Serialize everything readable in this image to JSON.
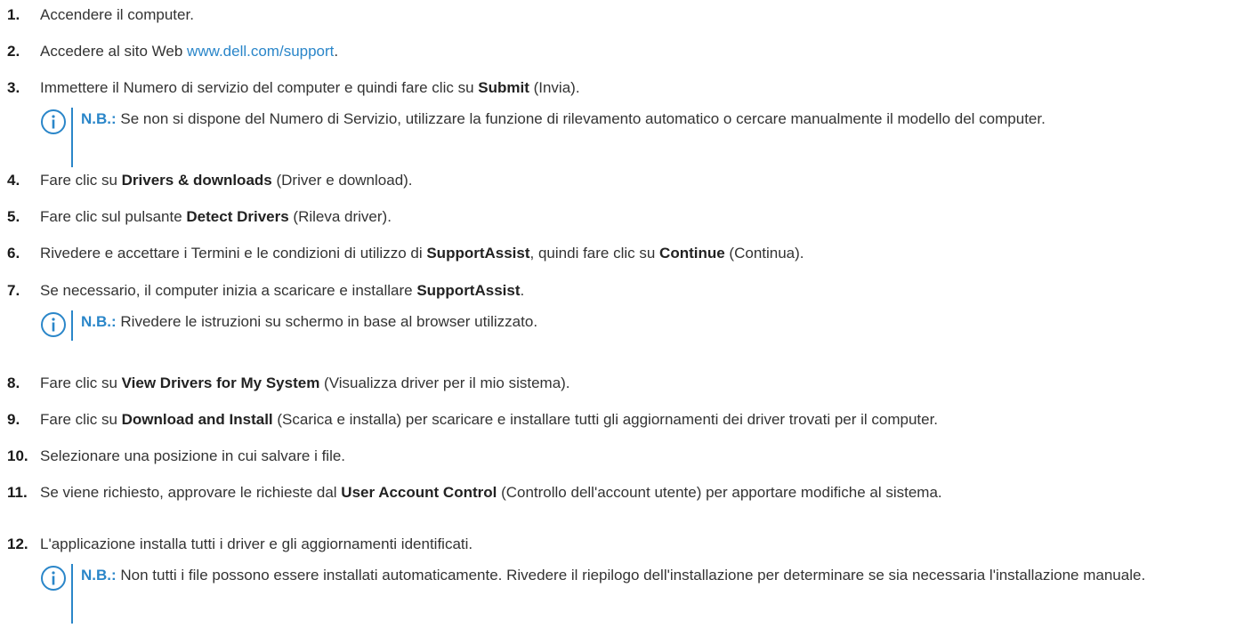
{
  "steps": [
    {
      "num": "1.",
      "parts": [
        {
          "t": "Accendere il computer."
        }
      ]
    },
    {
      "num": "2.",
      "parts": [
        {
          "t": "Accedere al sito Web "
        },
        {
          "t": "www.dell.com/support",
          "link": true
        },
        {
          "t": "."
        }
      ]
    },
    {
      "num": "3.",
      "parts": [
        {
          "t": "Immettere il Numero di servizio del computer e quindi fare clic su "
        },
        {
          "t": "Submit",
          "b": true
        },
        {
          "t": " (Invia)."
        }
      ]
    },
    {
      "num": "4.",
      "parts": [
        {
          "t": "Fare clic su "
        },
        {
          "t": "Drivers & downloads",
          "b": true
        },
        {
          "t": " (Driver e download)."
        }
      ]
    },
    {
      "num": "5.",
      "parts": [
        {
          "t": "Fare clic sul pulsante "
        },
        {
          "t": "Detect Drivers",
          "b": true
        },
        {
          "t": " (Rileva driver)."
        }
      ]
    },
    {
      "num": "6.",
      "parts": [
        {
          "t": "Rivedere e accettare i Termini e le condizioni di utilizzo di "
        },
        {
          "t": "SupportAssist",
          "b": true
        },
        {
          "t": ", quindi fare clic su "
        },
        {
          "t": "Continue",
          "b": true
        },
        {
          "t": " (Continua)."
        }
      ]
    },
    {
      "num": "7.",
      "parts": [
        {
          "t": "Se necessario, il computer inizia a scaricare e installare "
        },
        {
          "t": "SupportAssist",
          "b": true
        },
        {
          "t": "."
        }
      ]
    },
    {
      "num": "8.",
      "parts": [
        {
          "t": "Fare clic su "
        },
        {
          "t": "View Drivers for My System",
          "b": true
        },
        {
          "t": " (Visualizza driver per il mio sistema)."
        }
      ]
    },
    {
      "num": "9.",
      "parts": [
        {
          "t": "Fare clic su "
        },
        {
          "t": "Download and Install",
          "b": true
        },
        {
          "t": " (Scarica e installa) per scaricare e installare tutti gli aggiornamenti dei driver trovati per il computer."
        }
      ]
    },
    {
      "num": "10.",
      "parts": [
        {
          "t": "Selezionare una posizione in cui salvare i file."
        }
      ]
    },
    {
      "num": "11.",
      "parts": [
        {
          "t": "Se viene richiesto, approvare le richieste dal "
        },
        {
          "t": "User Account Control",
          "b": true
        },
        {
          "t": " (Controllo dell'account utente) per apportare modifiche al sistema."
        }
      ]
    },
    {
      "num": "12.",
      "parts": [
        {
          "t": "L'applicazione installa tutti i driver e gli aggiornamenti identificati."
        }
      ]
    }
  ],
  "notes": [
    {
      "label": "N.B.:",
      "text": " Se non si dispone del Numero di Servizio, utilizzare la funzione di rilevamento automatico o cercare manualmente il modello del computer."
    },
    {
      "label": "N.B.:",
      "text": " Rivedere le istruzioni su schermo in base al browser utilizzato."
    },
    {
      "label": "N.B.:",
      "text": " Non tutti i file possono essere installati automaticamente. Rivedere il riepilogo dell'installazione per determinare se sia necessaria l'installazione manuale."
    }
  ],
  "colors": {
    "accent": "#2a86c9",
    "text": "#333333"
  },
  "icons": {
    "note": "info-icon"
  }
}
